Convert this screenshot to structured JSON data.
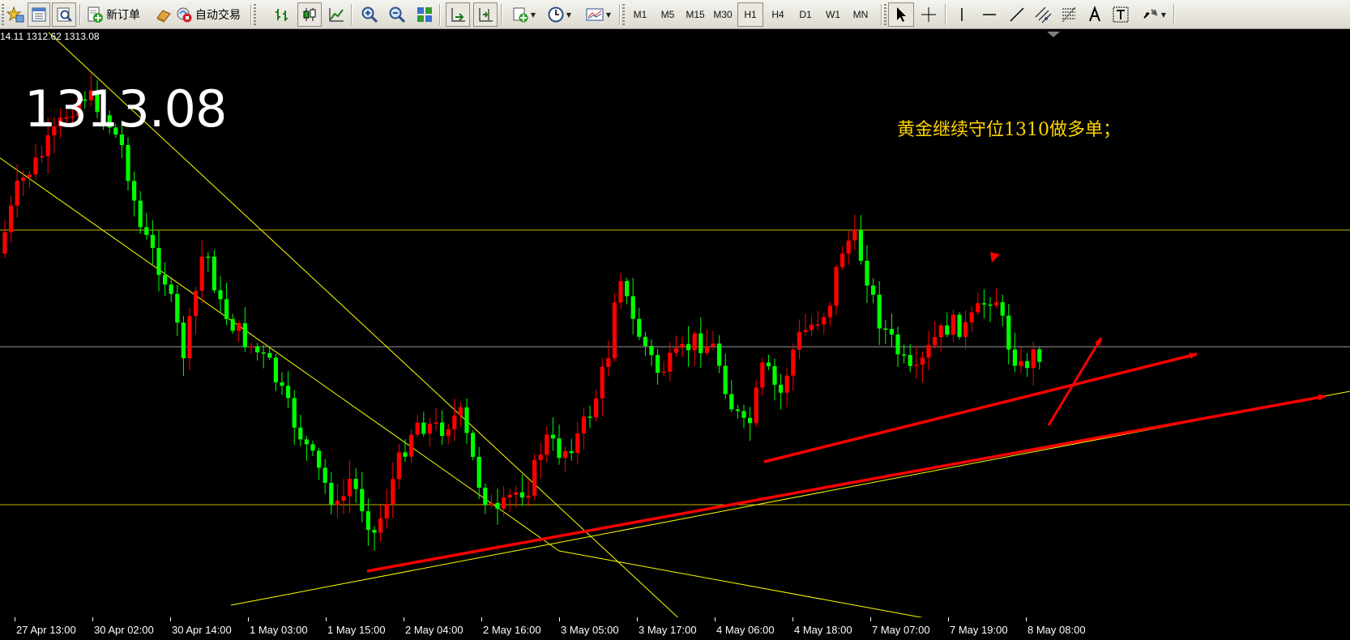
{
  "toolbar": {
    "new_order_label": "新订单",
    "auto_trading_label": "自动交易",
    "timeframes": [
      "M1",
      "M5",
      "M15",
      "M30",
      "H1",
      "H4",
      "D1",
      "W1",
      "MN"
    ],
    "active_timeframe": "H1",
    "icons": [
      "profiles-icon",
      "market-watch-icon",
      "navigator-icon",
      "new-order-icon",
      "expert-icon",
      "auto-trading-icon",
      "bar-chart-icon",
      "candlestick-icon",
      "line-chart-icon",
      "zoom-in-icon",
      "zoom-out-icon",
      "tile-windows-icon",
      "auto-scroll-icon",
      "chart-shift-icon",
      "indicators-icon",
      "periodicity-icon",
      "templates-icon",
      "cursor-icon",
      "crosshair-icon",
      "vertical-line-icon",
      "horizontal-line-icon",
      "trendline-icon",
      "channel-icon",
      "fibonacci-icon",
      "text-icon",
      "text-label-icon",
      "arrows-icon"
    ]
  },
  "chart": {
    "ohlc_text": "14.11 1312.62 1313.08",
    "current_price": "1313.08",
    "annotation": "黄金继续守位1310做多单；",
    "x_labels": [
      "27 Apr 13:00",
      "30 Apr 02:00",
      "30 Apr 14:00",
      "1 May 03:00",
      "1 May 15:00",
      "2 May 04:00",
      "2 May 16:00",
      "3 May 05:00",
      "3 May 17:00",
      "4 May 06:00",
      "4 May 18:00",
      "7 May 07:00",
      "7 May 19:00",
      "8 May 08:00"
    ],
    "colors": {
      "background": "#000000",
      "bull": "#ff0000",
      "bear": "#00ff00",
      "horizontal_lines": "#c8b400",
      "trend_lines": "#ffff00",
      "arrows": "#ff0000",
      "text": "#ffffff",
      "annotation": "#ffd400"
    }
  }
}
